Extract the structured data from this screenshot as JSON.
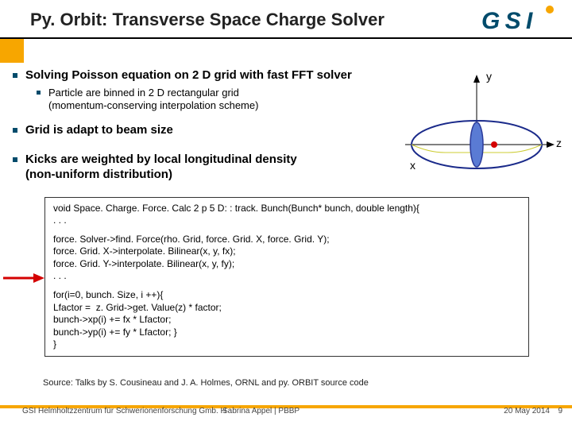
{
  "header": {
    "title": "Py. Orbit: Transverse Space Charge Solver",
    "logo_text": "GSI"
  },
  "bullets": {
    "b1": "Solving Poisson equation on 2 D grid with fast FFT solver",
    "b1a_l1": "Particle are binned in 2 D rectangular grid",
    "b1a_l2": "(momentum-conserving interpolation scheme)",
    "b2": "Grid is adapt to beam size",
    "b3_l1": "Kicks are weighted by local longitudinal density",
    "b3_l2": "(non-uniform distribution)"
  },
  "axes": {
    "y": "y",
    "z": "z",
    "x": "x"
  },
  "code": {
    "l1": "void Space. Charge. Force. Calc 2 p 5 D: : track. Bunch(Bunch* bunch, double length){",
    "l2": ". . .",
    "l3": "force. Solver->find. Force(rho. Grid, force. Grid. X, force. Grid. Y);",
    "l4": "force. Grid. X->interpolate. Bilinear(x, y, fx);",
    "l5": "force. Grid. Y->interpolate. Bilinear(x, y, fy);",
    "l6": ". . .",
    "l7": "for(i=0, bunch. Size, i ++){",
    "l8": "Lfactor =  z. Grid->get. Value(z) * factor;",
    "l9": "bunch->xp(i) += fx * Lfactor;",
    "l10": "bunch->yp(i) += fy * Lfactor; }",
    "l11": "}"
  },
  "source": "Source: Talks by S. Cousineau and  J. A. Holmes, ORNL and py. ORBIT source code",
  "footer": {
    "left": "GSI Helmholtzzentrum für Schwerionenforschung Gmb. H",
    "center": "Sabrina Appel | PBBP",
    "date": "20 May 2014",
    "page": "9"
  }
}
